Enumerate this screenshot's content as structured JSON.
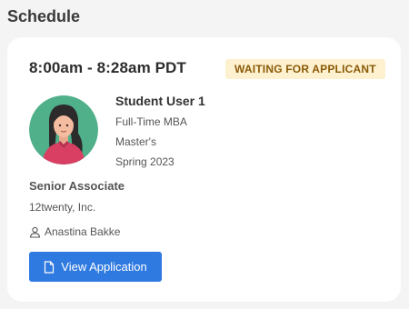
{
  "section": {
    "title": "Schedule"
  },
  "card": {
    "time_range": "8:00am - 8:28am PDT",
    "status_badge": "WAITING FOR APPLICANT",
    "student": {
      "name": "Student User 1",
      "program": "Full-Time MBA",
      "degree": "Master's",
      "term": "Spring 2023"
    },
    "position": "Senior Associate",
    "company": "12twenty, Inc.",
    "contact": {
      "name": "Anastina Bakke",
      "icon": "user-icon"
    },
    "view_button": {
      "label": "View Application",
      "icon": "document-icon"
    }
  },
  "colors": {
    "accent": "#2f7ae0",
    "badge_bg": "#fdf1cf",
    "badge_text": "#8a5a07",
    "avatar_bg": "#4fb08a"
  }
}
